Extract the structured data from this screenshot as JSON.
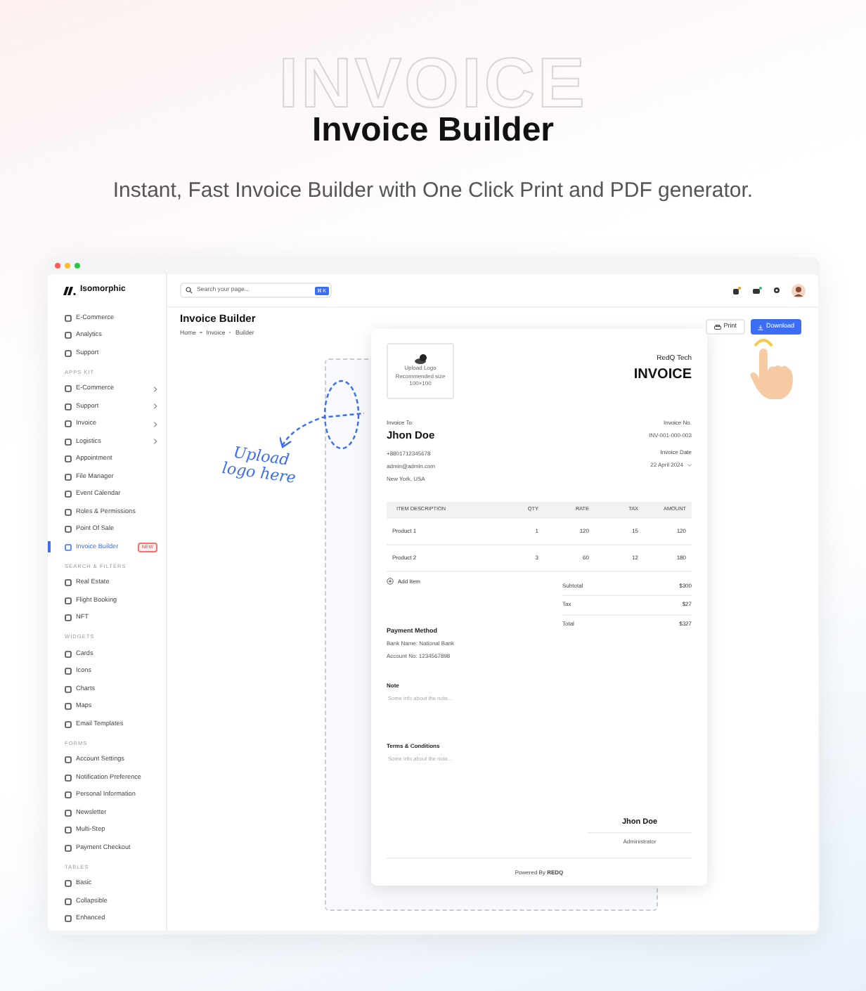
{
  "hero": {
    "watermark": "INVOICE",
    "title": "Invoice Builder",
    "subtitle": "Instant, Fast Invoice Builder with One Click Print and PDF generator."
  },
  "app": {
    "sidebar": {
      "logo": "Isomorphic",
      "sections": [
        {
          "items": [
            {
              "label": "E-Commerce",
              "has_submenu": false,
              "selected": false
            },
            {
              "label": "Analytics",
              "has_submenu": false,
              "selected": false
            },
            {
              "label": "Support",
              "has_submenu": false,
              "selected": false
            }
          ]
        },
        {
          "heading": "APPS KIT",
          "items": [
            {
              "label": "E-Commerce",
              "has_submenu": true,
              "selected": false
            },
            {
              "label": "Support",
              "has_submenu": true,
              "selected": false
            },
            {
              "label": "Invoice",
              "has_submenu": true,
              "selected": false
            },
            {
              "label": "Logistics",
              "has_submenu": true,
              "selected": false
            },
            {
              "label": "Appointment",
              "has_submenu": false,
              "selected": false
            },
            {
              "label": "File Manager",
              "has_submenu": false,
              "selected": false
            },
            {
              "label": "Event Calendar",
              "has_submenu": false,
              "selected": false
            },
            {
              "label": "Roles & Permissions",
              "has_submenu": false,
              "selected": false
            },
            {
              "label": "Point Of Sale",
              "has_submenu": false,
              "selected": false
            },
            {
              "label": "Invoice Builder",
              "has_submenu": false,
              "selected": true,
              "badge": "NEW"
            }
          ]
        },
        {
          "heading": "SEARCH & FILTERS",
          "items": [
            {
              "label": "Real Estate",
              "has_submenu": false,
              "selected": false
            },
            {
              "label": "Flight Booking",
              "has_submenu": false,
              "selected": false
            },
            {
              "label": "NFT",
              "has_submenu": false,
              "selected": false
            }
          ]
        },
        {
          "heading": "WIDGETS",
          "items": [
            {
              "label": "Cards",
              "has_submenu": false,
              "selected": false
            },
            {
              "label": "Icons",
              "has_submenu": false,
              "selected": false
            },
            {
              "label": "Charts",
              "has_submenu": false,
              "selected": false
            },
            {
              "label": "Maps",
              "has_submenu": false,
              "selected": false
            },
            {
              "label": "Email Templates",
              "has_submenu": false,
              "selected": false
            }
          ]
        },
        {
          "heading": "FORMS",
          "items": [
            {
              "label": "Account Settings",
              "has_submenu": false,
              "selected": false
            },
            {
              "label": "Notification Preference",
              "has_submenu": false,
              "selected": false
            },
            {
              "label": "Personal Information",
              "has_submenu": false,
              "selected": false
            },
            {
              "label": "Newsletter",
              "has_submenu": false,
              "selected": false
            },
            {
              "label": "Multi-Step",
              "has_submenu": false,
              "selected": false
            },
            {
              "label": "Payment Checkout",
              "has_submenu": false,
              "selected": false
            }
          ]
        },
        {
          "heading": "TABLES",
          "items": [
            {
              "label": "Basic",
              "has_submenu": false,
              "selected": false
            },
            {
              "label": "Collapsible",
              "has_submenu": false,
              "selected": false
            },
            {
              "label": "Enhanced",
              "has_submenu": false,
              "selected": false
            }
          ]
        }
      ]
    },
    "search": {
      "placeholder": "Search your page...",
      "shortcut": "⌘K"
    },
    "page": {
      "title": "Invoice Builder",
      "breadcrumb": [
        "Home",
        "Invoice",
        "Builder"
      ],
      "buttons": [
        {
          "label": "Print",
          "kind": "secondary"
        },
        {
          "label": "Download",
          "kind": "primary"
        }
      ]
    },
    "annotation": "Upload logo here",
    "invoice": {
      "logo_upload": [
        "Upload Logo",
        "Recommended size",
        "100×100"
      ],
      "company": "RedQ Tech",
      "title": "INVOICE",
      "to_label": "Invoice To:",
      "client": "Jhon Doe",
      "contact": [
        "+8801712345678",
        "admin@admin.com",
        "New York, USA"
      ],
      "number_label": "Invoice No.",
      "number": "INV-001-000-003",
      "date_label": "Invoice Date",
      "date": "22 April 2024",
      "columns": [
        "ITEM DESCRIPTION",
        "QTY",
        "RATE",
        "TAX",
        "AMOUNT"
      ],
      "rows": [
        [
          "Product 1",
          "1",
          "120",
          "15",
          "120"
        ],
        [
          "Product 2",
          "3",
          "60",
          "12",
          "180"
        ]
      ],
      "add_item": "Add Item",
      "totals": [
        {
          "label": "Subtotal",
          "value": "$300"
        },
        {
          "label": "Tax",
          "value": "$27"
        },
        {
          "label": "Total",
          "value": "$327"
        }
      ],
      "payment": {
        "heading": "Payment Method",
        "lines": [
          "Bank Name: National Bank",
          "Account No: 1234567898"
        ]
      },
      "note": {
        "heading": "Note",
        "placeholder": "Some info about the note..."
      },
      "terms": {
        "heading": "Terms & Conditions",
        "placeholder": "Some info about the note..."
      },
      "signature": {
        "name": "Jhon Doe",
        "role": "Administrator"
      },
      "footer": "Powered By **REDQ**"
    }
  }
}
